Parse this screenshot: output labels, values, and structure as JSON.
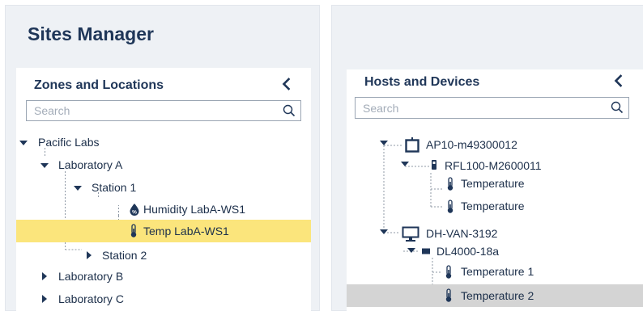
{
  "app": {
    "title": "Sites Manager"
  },
  "zones": {
    "title": "Zones and Locations",
    "search_placeholder": "Search",
    "items": [
      {
        "label": "Pacific Labs"
      },
      {
        "label": "Laboratory A"
      },
      {
        "label": "Station 1"
      },
      {
        "label": "Humidity LabA-WS1"
      },
      {
        "label": "Temp LabA-WS1"
      },
      {
        "label": "Station 2"
      },
      {
        "label": "Laboratory B"
      },
      {
        "label": "Laboratory C"
      }
    ]
  },
  "hosts": {
    "title": "Hosts and Devices",
    "search_placeholder": "Search",
    "items": [
      {
        "label": "AP10-m49300012"
      },
      {
        "label": "RFL100-M2600011"
      },
      {
        "label": "Temperature"
      },
      {
        "label": "Temperature"
      },
      {
        "label": "DH-VAN-3192"
      },
      {
        "label": "DL4000-18a"
      },
      {
        "label": "Temperature 1"
      },
      {
        "label": "Temperature 2"
      }
    ]
  },
  "colors": {
    "panel_bg": "#eef1f5",
    "title": "#1f3658",
    "selected_zone": "#fbe57c",
    "selected_host": "#d4d4d4"
  },
  "icons": {
    "zones_collapse": "chevron-left-icon",
    "hosts_collapse": "chevron-left-icon",
    "search": "search-icon",
    "humidity": "humidity-drop-icon",
    "temperature": "thermometer-icon",
    "access_point": "access-point-icon",
    "sensor": "sensor-device-icon",
    "computer": "computer-icon",
    "logger": "logger-device-icon"
  }
}
